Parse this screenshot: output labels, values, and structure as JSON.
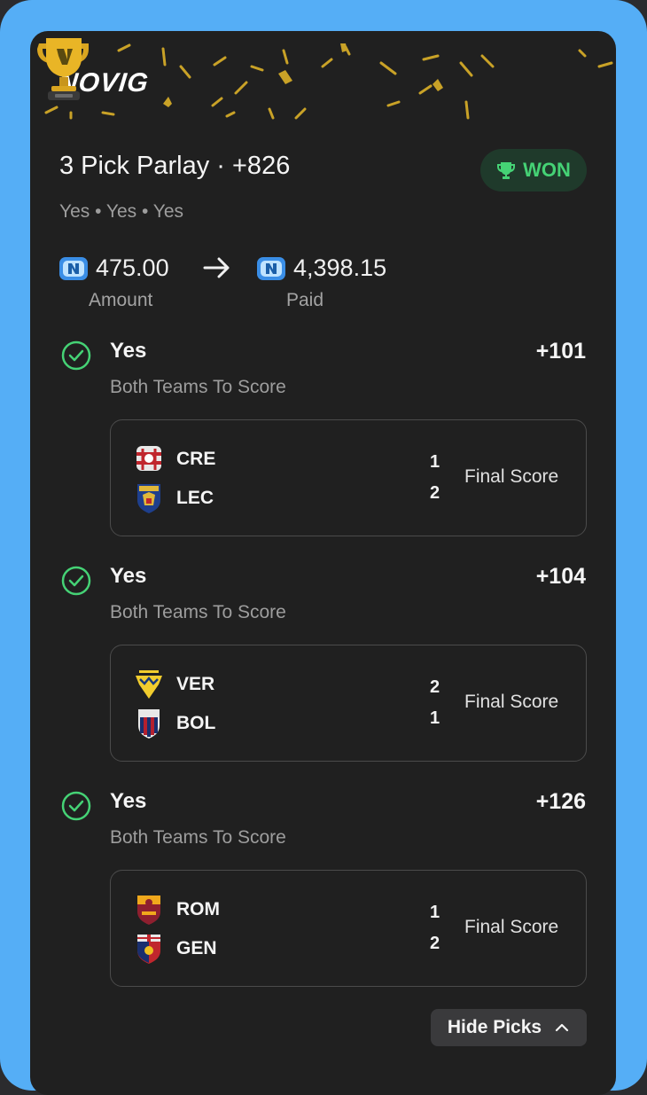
{
  "brand": {
    "logo_text": "NOVIG"
  },
  "bet": {
    "title": "3 Pick Parlay · +826",
    "status": "WON",
    "subtitle": "Yes • Yes • Yes",
    "amount_value": "475.00",
    "amount_label": "Amount",
    "paid_value": "4,398.15",
    "paid_label": "Paid"
  },
  "picks": [
    {
      "selection": "Yes",
      "odds": "+101",
      "market": "Both Teams To Score",
      "game": {
        "home": "CRE",
        "home_score": "1",
        "away": "LEC",
        "away_score": "2",
        "status": "Final Score"
      }
    },
    {
      "selection": "Yes",
      "odds": "+104",
      "market": "Both Teams To Score",
      "game": {
        "home": "VER",
        "home_score": "2",
        "away": "BOL",
        "away_score": "1",
        "status": "Final Score"
      }
    },
    {
      "selection": "Yes",
      "odds": "+126",
      "market": "Both Teams To Score",
      "game": {
        "home": "ROM",
        "home_score": "1",
        "away": "GEN",
        "away_score": "2",
        "status": "Final Score"
      }
    }
  ],
  "actions": {
    "hide_picks_label": "Hide Picks"
  },
  "icons": {
    "trophy": "trophy-icon",
    "check": "check-circle-icon",
    "coin": "novig-coin-icon",
    "arrow": "arrow-right-icon",
    "chevron": "chevron-up-icon"
  },
  "colors": {
    "accent": "#55aef6",
    "won_green": "#45d275",
    "card_bg": "#202020"
  }
}
